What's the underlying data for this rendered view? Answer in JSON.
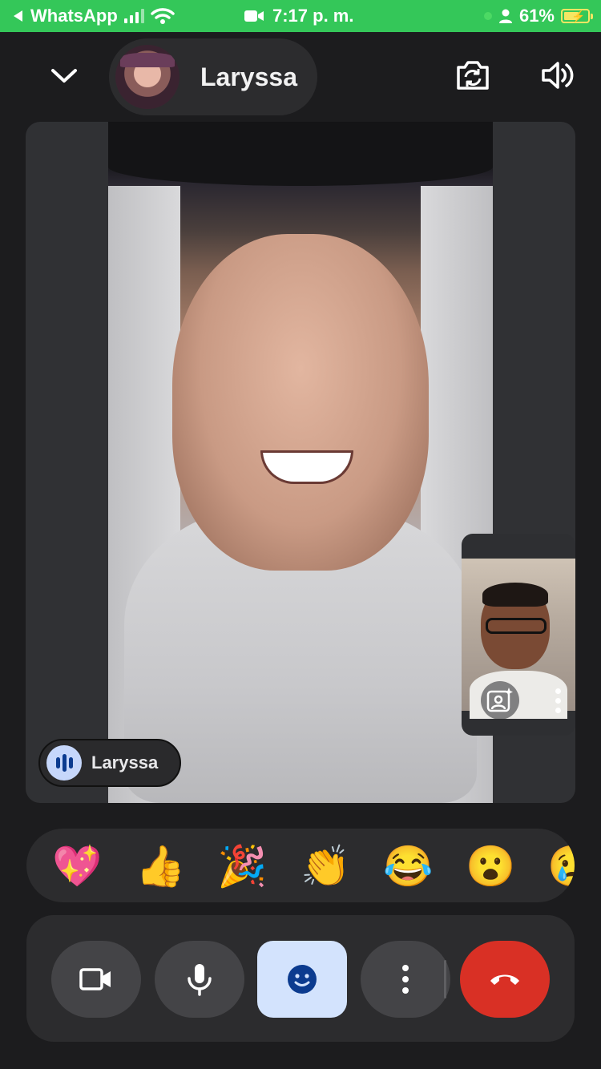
{
  "status_bar": {
    "back_app": "WhatsApp",
    "time": "7:17 p. m.",
    "battery": "61%"
  },
  "header": {
    "contact_name": "Laryssa"
  },
  "main_video": {
    "speaking_label": "Laryssa"
  },
  "reactions": [
    "💖",
    "👍",
    "🎉",
    "👏",
    "😂",
    "😮",
    "😢"
  ],
  "colors": {
    "status_bar": "#34c759",
    "end_call": "#d93025",
    "emoji_active_bg": "#d3e3fd",
    "speaking_icon_bg": "#c6d7fb"
  }
}
